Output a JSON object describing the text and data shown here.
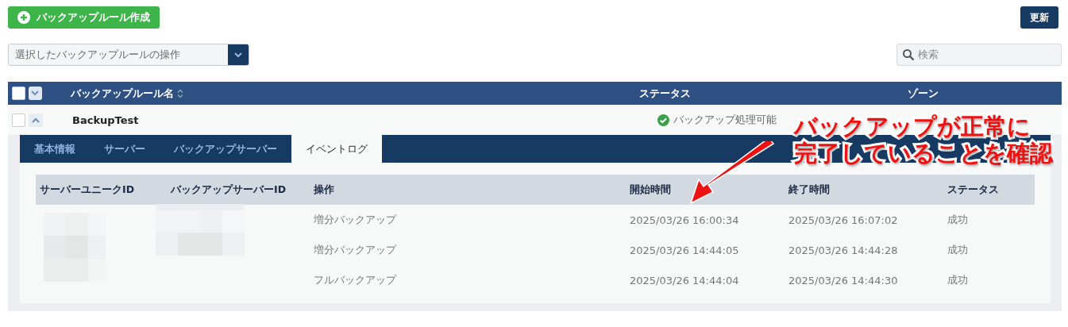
{
  "toolbar": {
    "create_button": "バックアップルール作成",
    "refresh_button": "更新"
  },
  "bulk_action": {
    "placeholder": "選択したバックアップルールの操作"
  },
  "search": {
    "placeholder": "検索"
  },
  "rules_table": {
    "header_checked": false,
    "columns": [
      "バックアップルール名",
      "ステータス",
      "ゾーン"
    ],
    "rows": [
      {
        "checked": false,
        "expanded": true,
        "name": "BackupTest",
        "status": "バックアップ処理可能",
        "status_ok": true
      }
    ]
  },
  "detail": {
    "tabs": [
      {
        "label": "基本情報",
        "selected": false
      },
      {
        "label": "サーバー",
        "selected": false
      },
      {
        "label": "バックアップサーバー",
        "selected": false
      },
      {
        "label": "イベントログ",
        "selected": true
      }
    ],
    "event_log": {
      "ids_redacted": true,
      "columns": [
        "サーバーユニークID",
        "バックアップサーバーID",
        "操作",
        "開始時間",
        "終了時間",
        "ステータス"
      ],
      "rows": [
        {
          "operation": "増分バックアップ",
          "start": "2025/03/26 16:00:34",
          "end": "2025/03/26 16:07:02",
          "status": "成功"
        },
        {
          "operation": "増分バックアップ",
          "start": "2025/03/26 14:44:05",
          "end": "2025/03/26 14:44:28",
          "status": "成功"
        },
        {
          "operation": "フルバックアップ",
          "start": "2025/03/26 14:44:04",
          "end": "2025/03/26 14:44:30",
          "status": "成功"
        }
      ]
    }
  },
  "annotation": {
    "lines": [
      "バックアップが正常に",
      "完了していることを確認"
    ]
  }
}
